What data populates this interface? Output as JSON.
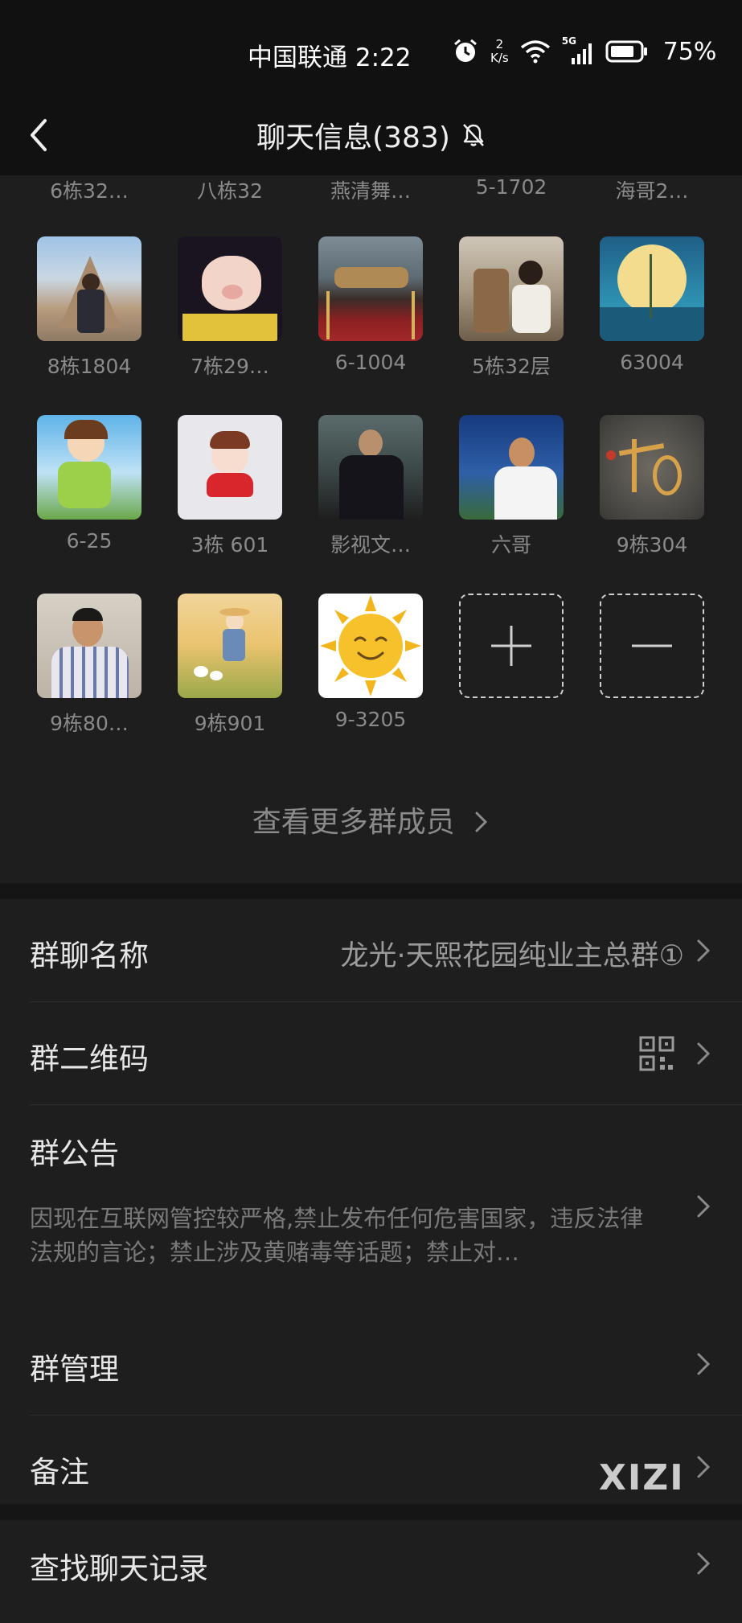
{
  "status_bar": {
    "carrier": "中国联通",
    "time": "2:22",
    "net_speed_value": "2",
    "net_speed_unit": "K/s",
    "signal_tag": "5G",
    "battery": "75%"
  },
  "header": {
    "title": "聊天信息(383)"
  },
  "clipped_names": [
    "6栋32…",
    "八栋32",
    "燕清舞…",
    "5-1702",
    "海哥2…"
  ],
  "members": [
    {
      "name": "8栋1804"
    },
    {
      "name": "7栋29…"
    },
    {
      "name": "6-1004"
    },
    {
      "name": "5栋32层"
    },
    {
      "name": "63004"
    },
    {
      "name": "6-25"
    },
    {
      "name": "3栋 601"
    },
    {
      "name": "影视文…"
    },
    {
      "name": "六哥"
    },
    {
      "name": "9栋304"
    },
    {
      "name": "9栋80…"
    },
    {
      "name": "9栋901"
    },
    {
      "name": "9-3205"
    }
  ],
  "view_more": "查看更多群成员",
  "settings": {
    "group_name_label": "群聊名称",
    "group_name_value": "龙光·天熙花园纯业主总群①",
    "qr_label": "群二维码",
    "notice_label": "群公告",
    "notice_text": "因现在互联网管控较严格,禁止发布任何危害国家，违反法律法规的言论；禁止涉及黄赌毒等话题；禁止对…",
    "manage_label": "群管理",
    "remark_label": "备注",
    "search_label": "查找聊天记录"
  },
  "watermark": "XIZI"
}
